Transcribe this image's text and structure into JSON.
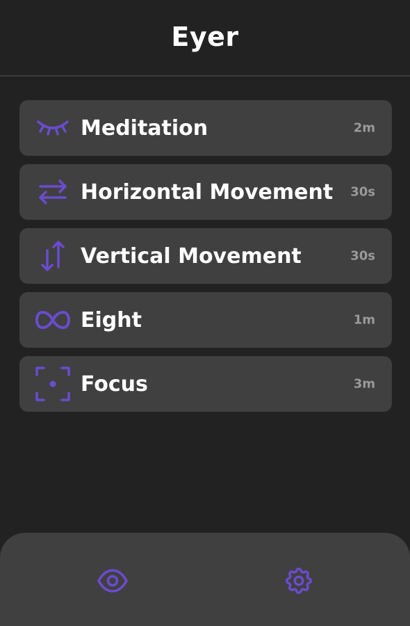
{
  "app": {
    "title": "Eyer"
  },
  "colors": {
    "background": "#222222",
    "card": "#404040",
    "accent": "#6a4ccf",
    "text": "#ffffff",
    "muted": "#9a9a9a"
  },
  "exercises": [
    {
      "label": "Meditation",
      "duration": "2m",
      "icon": "closed-eye-icon"
    },
    {
      "label": "Horizontal Movement",
      "duration": "30s",
      "icon": "horizontal-arrows-icon"
    },
    {
      "label": "Vertical Movement",
      "duration": "30s",
      "icon": "vertical-arrows-icon"
    },
    {
      "label": "Eight",
      "duration": "1m",
      "icon": "infinity-icon"
    },
    {
      "label": "Focus",
      "duration": "3m",
      "icon": "focus-frame-icon"
    }
  ],
  "nav": {
    "items": [
      {
        "icon": "eye-icon"
      },
      {
        "icon": "gear-icon"
      }
    ]
  }
}
